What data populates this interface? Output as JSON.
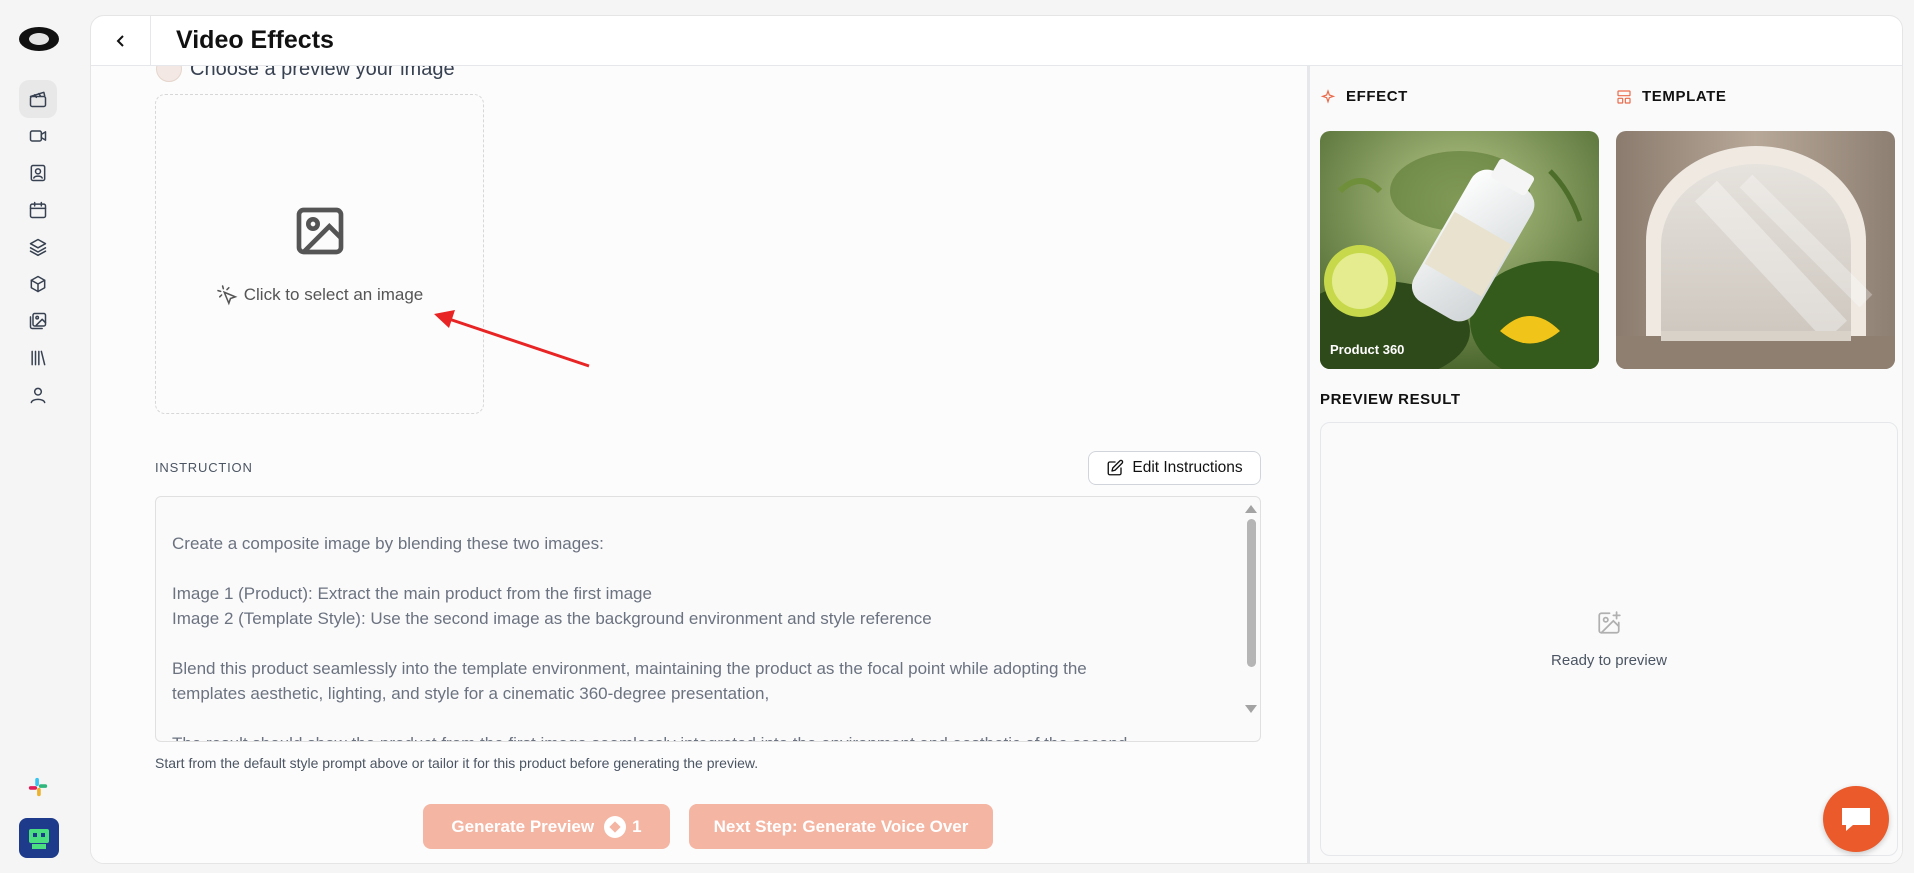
{
  "header": {
    "title": "Video Effects"
  },
  "upload": {
    "step_label": "Choose a preview your image",
    "cta": "Click to select an image"
  },
  "instruction": {
    "label": "INSTRUCTION",
    "edit_button": "Edit Instructions",
    "text": "Create a composite image by blending these two images:\n\nImage 1 (Product): Extract the main product from the first image\nImage 2 (Template Style): Use the second image as the background environment and style reference\n\nBlend this product seamlessly into the template environment, maintaining the product as the focal point while adopting the\ntemplates aesthetic, lighting, and style for a cinematic 360-degree presentation,\n\nThe result should show the product from the first image seamlessly integrated into the environment and aesthetic of the second",
    "hint": "Start from the default style prompt above or tailor it for this product before generating the preview."
  },
  "actions": {
    "generate_label": "Generate Preview",
    "generate_credits": "1",
    "next_label": "Next Step: Generate Voice Over"
  },
  "panel": {
    "effect_heading": "EFFECT",
    "effect_name": "Product 360",
    "template_heading": "TEMPLATE",
    "preview_heading": "PREVIEW RESULT",
    "preview_empty": "Ready to preview"
  },
  "colors": {
    "accent": "#ea5a2a",
    "button_disabled": "#f4b5a3"
  },
  "icons": [
    "logo",
    "clapperboard-icon",
    "video-icon",
    "contact-icon",
    "calendar-icon",
    "layers-icon",
    "box-icon",
    "images-icon",
    "library-icon",
    "user-icon",
    "slack-icon",
    "bot-avatar",
    "chat-icon"
  ]
}
